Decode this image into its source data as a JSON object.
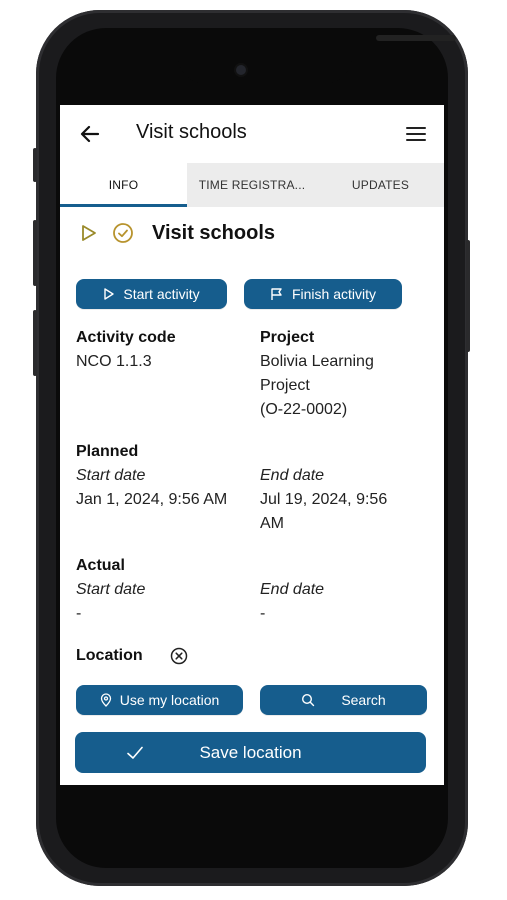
{
  "appbar": {
    "title": "Visit schools"
  },
  "tabs": [
    {
      "label": "INFO",
      "active": true
    },
    {
      "label": "TIME REGISTRA...",
      "active": false
    },
    {
      "label": "UPDATES",
      "active": false
    }
  ],
  "activity": {
    "title": "Visit schools"
  },
  "actions": {
    "start_label": "Start activity",
    "finish_label": "Finish activity"
  },
  "info": {
    "activity_code_label": "Activity code",
    "activity_code_value": "NCO 1.1.3",
    "project_label": "Project",
    "project_line1": "Bolivia Learning",
    "project_line2": "Project",
    "project_line3": "(O-22-0002)"
  },
  "planned": {
    "label": "Planned",
    "start_label": "Start date",
    "start_value": "Jan 1, 2024, 9:56 AM",
    "end_label": "End date",
    "end_value_line1": "Jul 19, 2024, 9:56",
    "end_value_line2": "AM"
  },
  "actual": {
    "label": "Actual",
    "start_label": "Start date",
    "start_value": "-",
    "end_label": "End date",
    "end_value": "-"
  },
  "location": {
    "label": "Location",
    "use_my_location_label": "Use my location",
    "search_label": "Search",
    "save_label": "Save location"
  },
  "colors": {
    "primary": "#165d8d",
    "accent_olive": "#9a8a2a",
    "tab_bg": "#ececec"
  },
  "icons": [
    "back-arrow-icon",
    "hamburger-menu-icon",
    "play-outline-icon",
    "check-circle-icon",
    "play-icon",
    "flag-icon",
    "clear-circle-icon",
    "location-pin-icon",
    "search-icon",
    "checkmark-icon"
  ]
}
